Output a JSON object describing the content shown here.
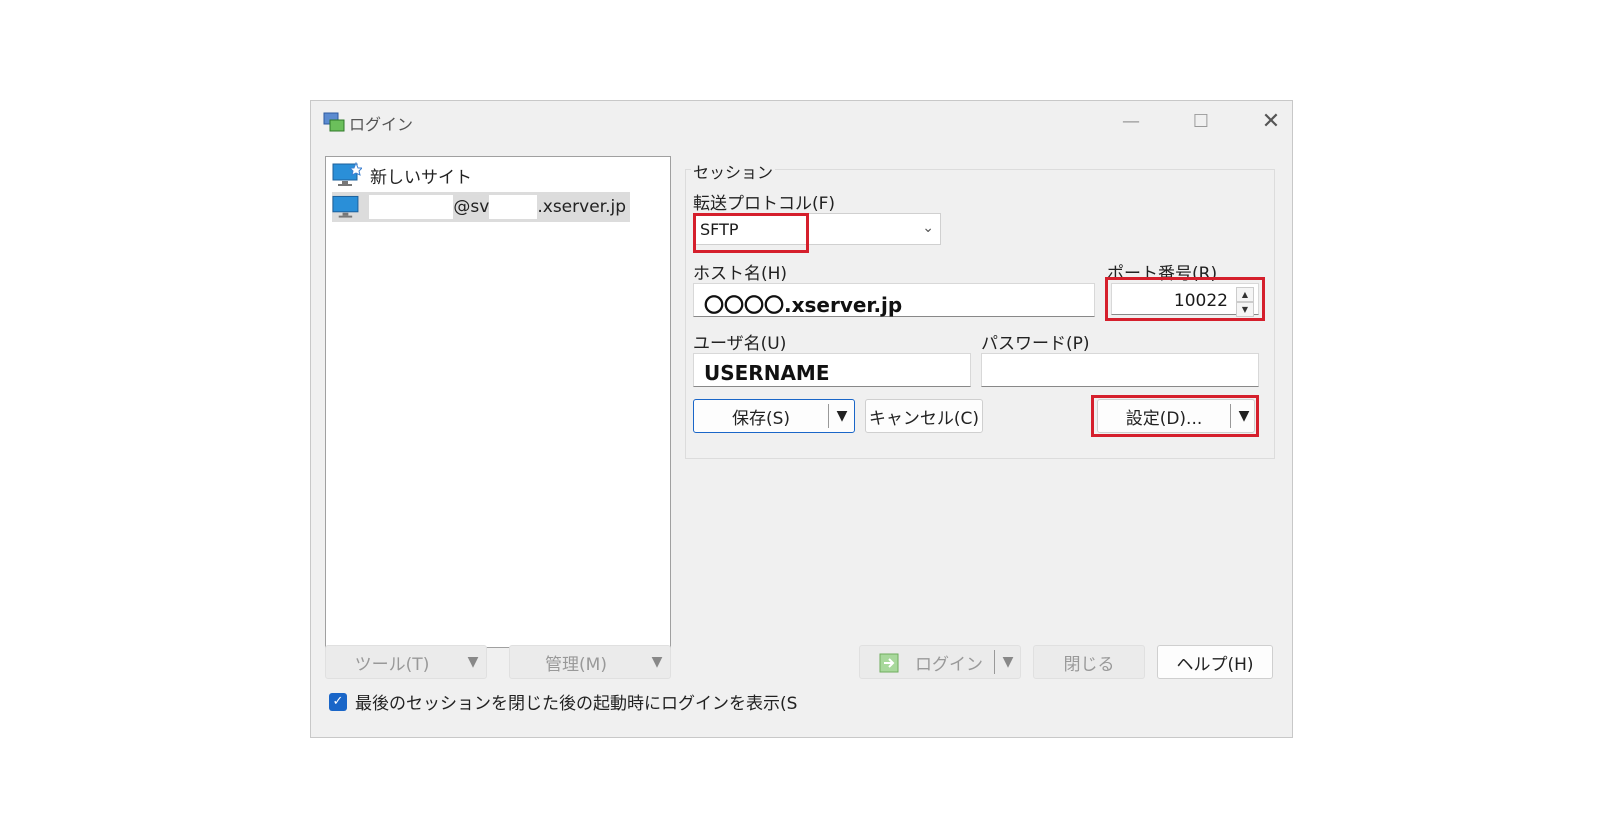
{
  "window": {
    "title": "ログイン",
    "min_glyph": "—",
    "max_glyph": "☐",
    "close_glyph": "✕"
  },
  "sites": {
    "new_site_label": "新しいサイト",
    "saved_site": {
      "mid": "@sv",
      "suffix": ".xserver.jp"
    }
  },
  "session": {
    "group_label": "セッション",
    "protocol_label": "転送プロトコル(F)",
    "protocol_value": "SFTP",
    "host_label": "ホスト名(H)",
    "host_value": "〇〇〇〇.xserver.jp",
    "port_label": "ポート番号(R)",
    "port_value": "10022",
    "user_label": "ユーザ名(U)",
    "user_value": "USERNAME",
    "password_label": "パスワード(P)",
    "password_value": "",
    "save_button": "保存(S)",
    "cancel_button": "キャンセル(C)",
    "settings_button": "設定(D)..."
  },
  "footer": {
    "tools_button": "ツール(T)",
    "manage_button": "管理(M)",
    "login_button": "ログイン",
    "close_button": "閉じる",
    "help_button": "ヘルプ(H)",
    "checkbox_label": "最後のセッションを閉じた後の起動時にログインを表示(S",
    "checkbox_checked": true
  },
  "colors": {
    "highlight": "#d51f2c",
    "accent": "#1a66c8"
  }
}
